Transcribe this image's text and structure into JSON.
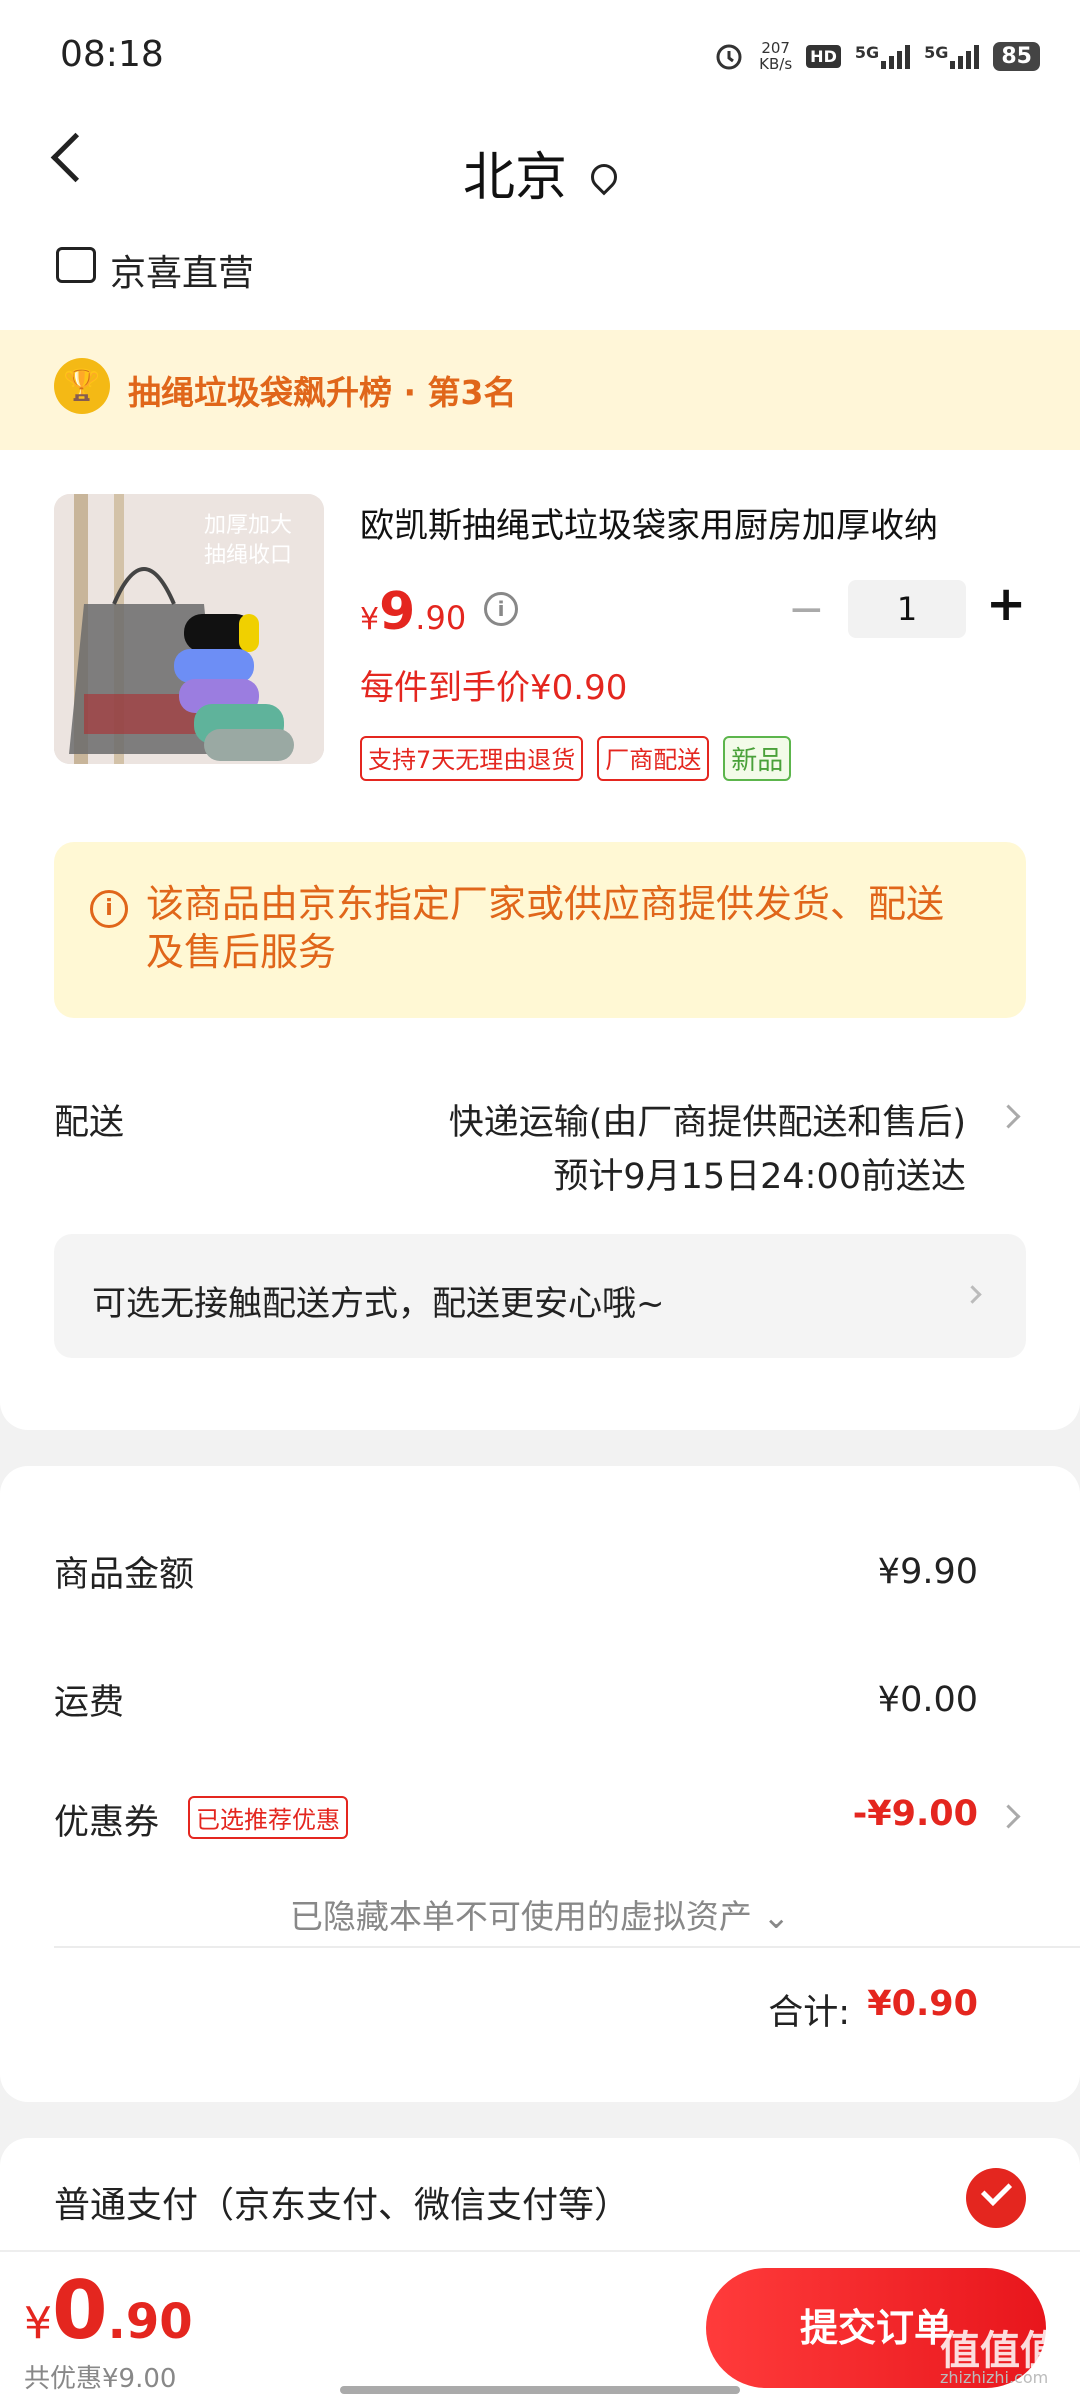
{
  "status_bar": {
    "time": "08:18",
    "net_speed": "207\nKB/s",
    "hd": "HD",
    "sig1": "5G",
    "sig2": "5G",
    "battery": "85"
  },
  "header": {
    "title": "北京",
    "store_name": "京喜直营"
  },
  "ranking": {
    "text": "抽绳垃圾袋飙升榜 · 第3名"
  },
  "product": {
    "name": "欧凯斯抽绳式垃圾袋家用厨房加厚收纳",
    "price_symbol": "¥",
    "price_int": "9",
    "price_dec": ".90",
    "quantity": "1",
    "unit_price": "每件到手价¥0.90",
    "tags": [
      "支持7天无理由退货",
      "厂商配送",
      "新品"
    ],
    "image_caption": "加厚加大\n抽绳收口"
  },
  "notice": {
    "text": "该商品由京东指定厂家或供应商提供发货、配送及售后服务"
  },
  "shipping": {
    "label": "配送",
    "method": "快递运输(由厂商提供配送和售后)",
    "eta": "预计9月15日24:00前送达",
    "contactless": "可选无接触配送方式，配送更安心哦~"
  },
  "amounts": {
    "goods_label": "商品金额",
    "goods_value": "¥9.90",
    "freight_label": "运费",
    "freight_value": "¥0.00",
    "coupon_label": "优惠券",
    "coupon_badge": "已选推荐优惠",
    "coupon_value": "-¥9.00",
    "hidden_assets": "已隐藏本单不可使用的虚拟资产 ⌄",
    "total_label": "合计:",
    "total_value": "¥0.90"
  },
  "payment": {
    "label": "普通支付（京东支付、微信支付等）"
  },
  "bottom": {
    "price_symbol": "¥",
    "price_int": "0",
    "price_dec": ".90",
    "saved": "共优惠¥9.00",
    "submit": "提交订单",
    "watermark": "值值值",
    "watermark_small": "zhizhizhi.com"
  },
  "colors": {
    "accent_red": "#e4261f",
    "warning_orange": "#e0661a",
    "banner_yellow": "#fff6d8"
  }
}
